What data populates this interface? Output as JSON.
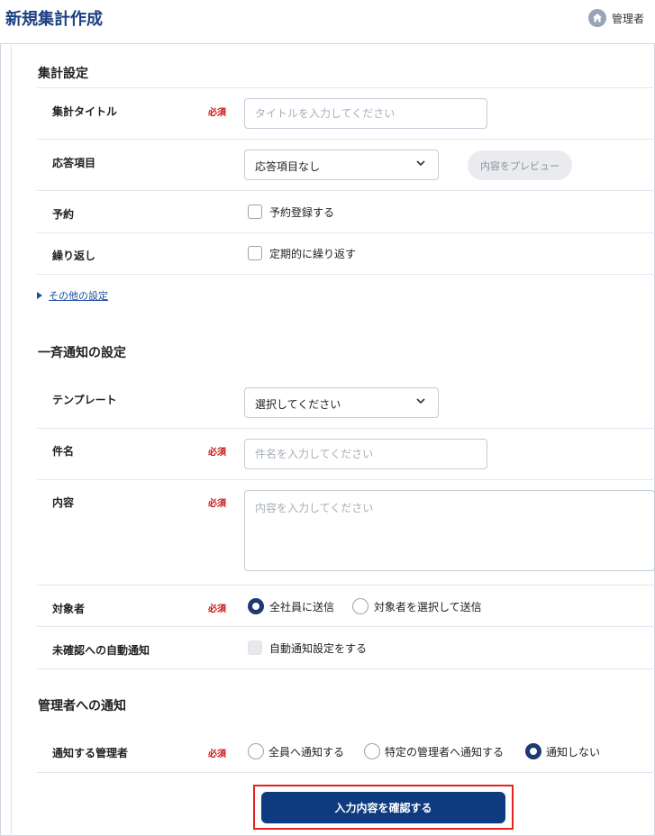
{
  "header": {
    "title": "新規集計作成",
    "admin_label": "管理者"
  },
  "required_label": "必須",
  "aggregate_settings": {
    "section_title": "集計設定",
    "title_row": {
      "label": "集計タイトル",
      "placeholder": "タイトルを入力してください"
    },
    "answer_row": {
      "label": "応答項目",
      "selected": "応答項目なし",
      "preview_label": "内容をプレビュー"
    },
    "reservation_row": {
      "label": "予約",
      "checkbox_label": "予約登録する"
    },
    "repeat_row": {
      "label": "繰り返し",
      "checkbox_label": "定期的に繰り返す"
    },
    "other_settings_link": "その他の設定"
  },
  "notification_settings": {
    "section_title": "一斉通知の設定",
    "template_row": {
      "label": "テンプレート",
      "selected": "選択してください"
    },
    "subject_row": {
      "label": "件名",
      "placeholder": "件名を入力してください"
    },
    "content_row": {
      "label": "内容",
      "placeholder": "内容を入力してください"
    },
    "target_row": {
      "label": "対象者",
      "options": [
        {
          "label": "全社員に送信",
          "checked": true
        },
        {
          "label": "対象者を選択して送信",
          "checked": false
        }
      ]
    },
    "auto_notify_row": {
      "label": "未確認への自動通知",
      "checkbox_label": "自動通知設定をする"
    }
  },
  "admin_notification": {
    "section_title": "管理者への通知",
    "notify_row": {
      "label": "通知する管理者",
      "options": [
        {
          "label": "全員へ通知する",
          "checked": false
        },
        {
          "label": "特定の管理者へ通知する",
          "checked": false
        },
        {
          "label": "通知しない",
          "checked": true
        }
      ]
    }
  },
  "submit_label": "入力内容を確認する",
  "colors": {
    "primary": "#0e3b7f",
    "title": "#1c3f82",
    "required": "#cc1414",
    "highlight_outline": "#e32222"
  }
}
